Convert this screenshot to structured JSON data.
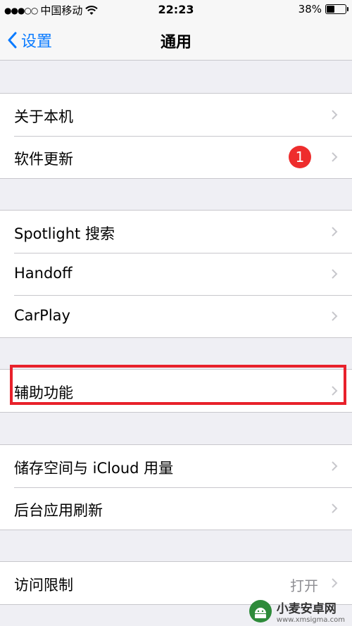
{
  "status_bar": {
    "signal": "●●●○○",
    "carrier": "中国移动",
    "time": "22:23",
    "battery_text": "38%",
    "battery_level": 0.38
  },
  "nav": {
    "back_label": "设置",
    "title": "通用"
  },
  "groups": [
    {
      "rows": [
        {
          "label": "关于本机"
        },
        {
          "label": "软件更新",
          "badge": "1"
        }
      ]
    },
    {
      "rows": [
        {
          "label": "Spotlight 搜索"
        },
        {
          "label": "Handoff"
        },
        {
          "label": "CarPlay"
        }
      ]
    },
    {
      "rows": [
        {
          "label": "辅助功能"
        }
      ]
    },
    {
      "rows": [
        {
          "label": "储存空间与 iCloud 用量"
        },
        {
          "label": "后台应用刷新"
        }
      ]
    },
    {
      "rows": [
        {
          "label": "访问限制",
          "detail": "打开"
        }
      ]
    }
  ],
  "watermark": {
    "title": "小麦安卓网",
    "url": "www.xmsigma.com"
  },
  "colors": {
    "accent": "#0a7bff",
    "badge": "#ee2d2d",
    "highlight": "#e8212b",
    "background": "#efeff4"
  }
}
